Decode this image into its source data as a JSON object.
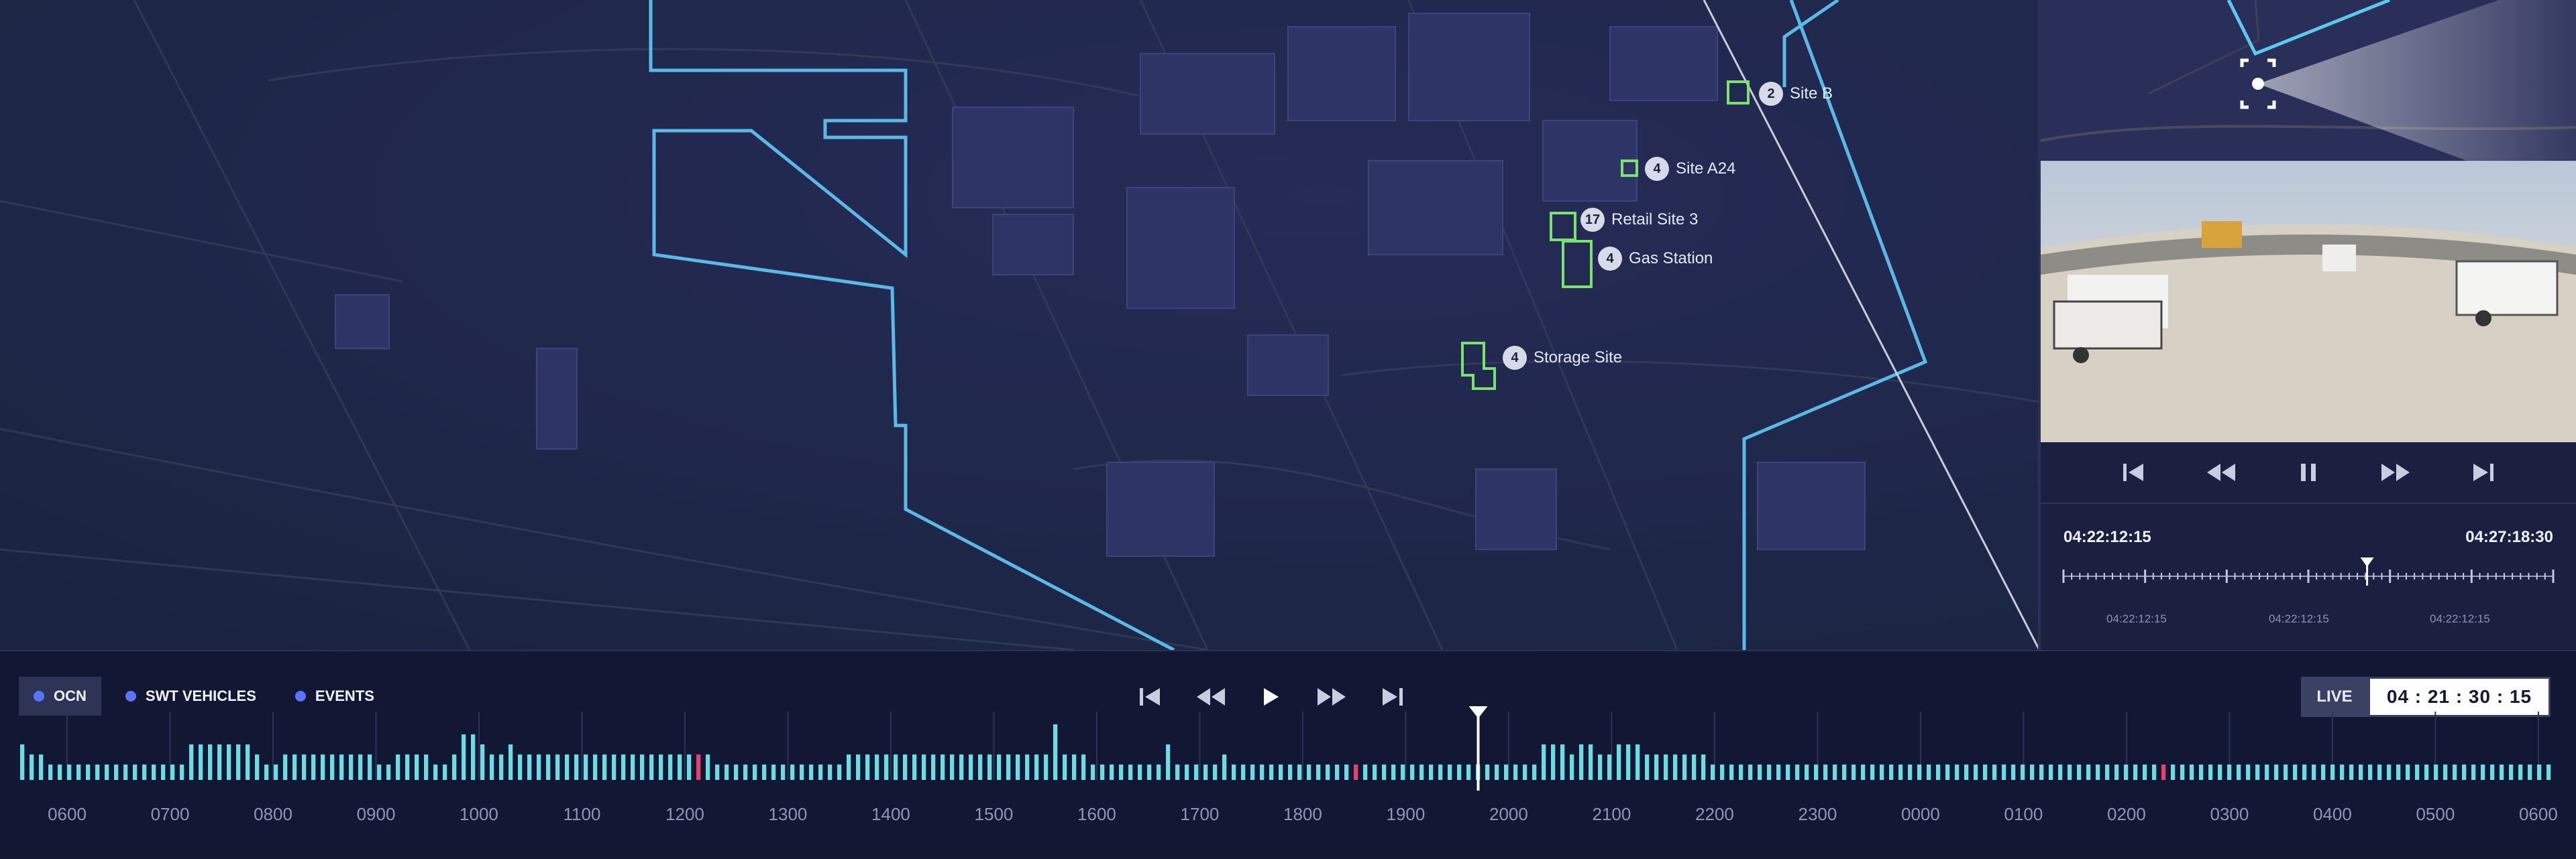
{
  "map": {
    "sites": [
      {
        "count": "2",
        "name": "Site B"
      },
      {
        "count": "4",
        "name": "Site A24"
      },
      {
        "count": "17",
        "name": "Retail Site 3"
      },
      {
        "count": "4",
        "name": "Gas Station"
      },
      {
        "count": "4",
        "name": "Storage Site"
      }
    ]
  },
  "camera": {
    "start_time": "04:22:12:15",
    "end_time": "04:27:18:30",
    "tick_labels": [
      "04:22:12:15",
      "04:22:12:15",
      "04:22:12:15"
    ],
    "scrub_position": 0.62
  },
  "legend": {
    "items": [
      {
        "label": "OCN",
        "active": true
      },
      {
        "label": "SWT VEHICLES",
        "active": false
      },
      {
        "label": "EVENTS",
        "active": false
      }
    ]
  },
  "live": {
    "label": "LIVE",
    "time": "04 : 21 : 30 : 15"
  },
  "timeline": {
    "hours": [
      "0600",
      "0700",
      "0800",
      "0900",
      "1000",
      "1100",
      "1200",
      "1300",
      "1400",
      "1500",
      "1600",
      "1700",
      "1800",
      "1900",
      "2000",
      "2100",
      "2200",
      "2300",
      "0000",
      "0100",
      "0200",
      "0300",
      "0400",
      "0500",
      "0600"
    ],
    "bars": [
      3,
      2,
      2,
      1,
      1,
      1,
      1,
      1,
      1,
      1,
      1,
      1,
      1,
      1,
      1,
      1,
      1,
      1,
      3,
      3,
      3,
      3,
      3,
      3,
      3,
      2,
      1,
      1,
      2,
      2,
      2,
      2,
      2,
      2,
      2,
      2,
      2,
      2,
      1,
      1,
      2,
      2,
      2,
      2,
      1,
      1,
      2,
      4,
      4,
      3,
      2,
      2,
      3,
      2,
      2,
      2,
      2,
      2,
      2,
      2,
      2,
      2,
      2,
      2,
      2,
      2,
      2,
      2,
      2,
      2,
      2,
      2,
      2,
      2,
      1,
      1,
      1,
      1,
      1,
      1,
      1,
      1,
      1,
      1,
      1,
      1,
      1,
      1,
      2,
      2,
      2,
      2,
      2,
      2,
      2,
      2,
      2,
      2,
      2,
      2,
      2,
      2,
      2,
      2,
      2,
      2,
      2,
      2,
      2,
      2,
      5,
      2,
      2,
      2,
      1,
      1,
      1,
      1,
      1,
      1,
      1,
      1,
      3,
      1,
      1,
      1,
      1,
      1,
      2,
      1,
      1,
      1,
      1,
      1,
      1,
      1,
      1,
      1,
      1,
      1,
      1,
      1,
      1,
      1,
      1,
      1,
      1,
      1,
      1,
      1,
      1,
      1,
      1,
      1,
      1,
      1,
      1,
      1,
      1,
      1,
      1,
      1,
      3,
      3,
      3,
      2,
      3,
      3,
      2,
      2,
      3,
      3,
      3,
      2,
      2,
      2,
      2,
      2,
      2,
      2,
      1,
      1,
      1,
      1,
      1,
      1,
      1,
      1,
      1,
      1,
      1,
      1,
      1,
      1,
      1,
      1,
      1,
      1,
      1,
      1,
      1,
      1,
      1,
      1,
      1,
      1,
      1,
      1,
      1,
      1,
      1,
      1,
      1,
      1,
      1,
      1,
      1,
      1,
      1,
      1,
      1,
      1,
      1,
      1,
      1,
      1,
      1,
      1,
      1,
      1,
      1,
      1,
      1,
      1,
      1,
      1,
      1,
      1,
      1,
      1,
      1,
      1,
      1,
      1,
      1,
      1,
      1,
      1,
      1,
      1,
      1,
      1,
      1,
      1,
      1,
      1,
      1,
      1,
      1,
      1,
      1,
      1,
      1,
      1,
      1,
      1,
      1,
      1,
      1,
      1
    ],
    "event_bar_indices": [
      72,
      142,
      228
    ],
    "playhead_fraction": 0.575,
    "colors": {
      "bar": "#6fd9e4",
      "event": "#e0446b",
      "playhead": "#ffffff"
    }
  }
}
